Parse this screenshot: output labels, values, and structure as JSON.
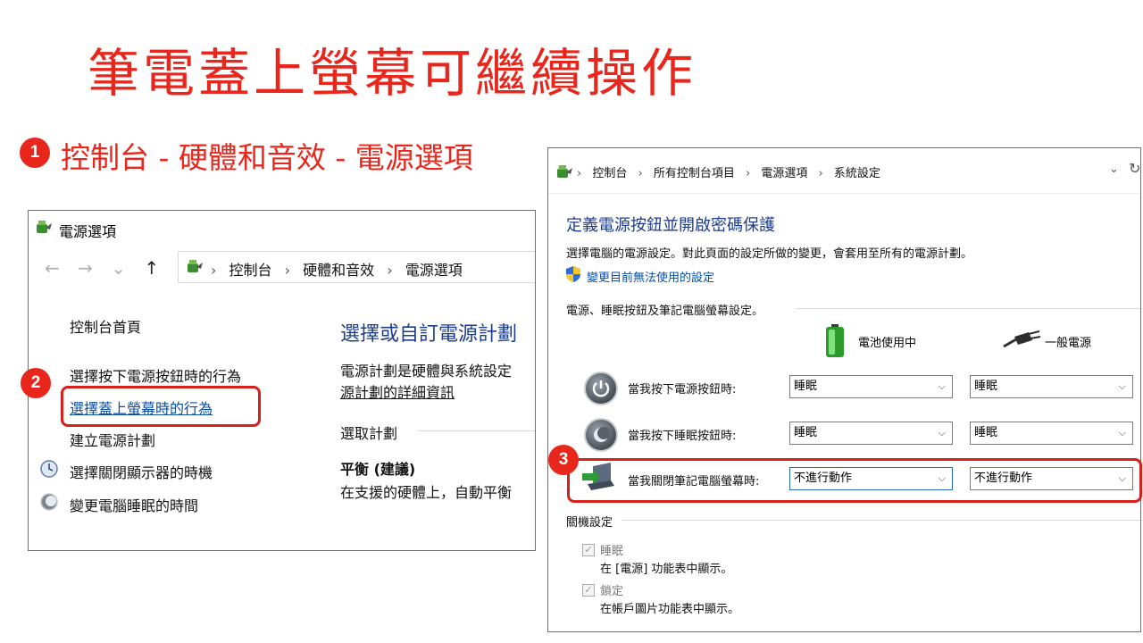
{
  "slide": {
    "title": "筆電蓋上螢幕可繼續操作",
    "step1_number": "1",
    "step1_text": "控制台 - 硬體和音效 - 電源選項",
    "step2_number": "2",
    "step3_number": "3",
    "highlight_color": "#e8261c"
  },
  "left_window": {
    "title": "電源選項",
    "title_icon": "power-options-icon",
    "nav": {
      "back": "←",
      "forward": "→",
      "dropdown": "⌄",
      "up": "↑"
    },
    "breadcrumbs": [
      "控制台",
      "硬體和音效",
      "電源選項"
    ],
    "breadcrumb_sep": "›",
    "sidebar": {
      "home": "控制台首頁",
      "items": [
        {
          "label": "選擇按下電源按鈕時的行為"
        },
        {
          "label": "選擇蓋上螢幕時的行為"
        },
        {
          "label": "建立電源計劃"
        },
        {
          "label": "選擇關閉顯示器的時機",
          "icon": "monitor-clock-icon"
        },
        {
          "label": "變更電腦睡眠的時間",
          "icon": "sleep-moon-icon"
        }
      ]
    },
    "main": {
      "title": "選擇或自訂電源計劃",
      "desc_line1": "電源計劃是硬體與系統設定",
      "desc_link": "源計劃的詳細資訊",
      "section_label": "選取計劃",
      "plan_name": "平衡 (建議)",
      "plan_desc": "在支援的硬體上，自動平衡"
    }
  },
  "right_window": {
    "breadcrumbs": [
      "控制台",
      "所有控制台項目",
      "電源選項",
      "系統設定"
    ],
    "breadcrumb_sep": "›",
    "heading": "定義電源按鈕並開啟密碼保護",
    "description": "選擇電腦的電源設定。對此頁面的設定所做的變更，會套用至所有的電源計劃。",
    "admin_link": "變更目前無法使用的設定",
    "group_label": "電源、睡眠按鈕及筆記電腦螢幕設定。",
    "col_battery": "電池使用中",
    "col_plugged": "一般電源",
    "rows": [
      {
        "label": "當我按下電源按鈕時:",
        "battery": "睡眠",
        "plugged": "睡眠",
        "icon": "power-button-icon"
      },
      {
        "label": "當我按下睡眠按鈕時:",
        "battery": "睡眠",
        "plugged": "睡眠",
        "icon": "sleep-button-icon"
      },
      {
        "label": "當我關閉筆記電腦螢幕時:",
        "battery": "不進行動作",
        "plugged": "不進行動作",
        "icon": "laptop-lid-icon"
      }
    ],
    "shutdown_label": "關機設定",
    "shutdown_items": [
      {
        "label": "睡眠",
        "desc": "在 [電源] 功能表中顯示。",
        "checked": true
      },
      {
        "label": "鎖定",
        "desc": "在帳戶圖片功能表中顯示。",
        "checked": true
      }
    ]
  }
}
